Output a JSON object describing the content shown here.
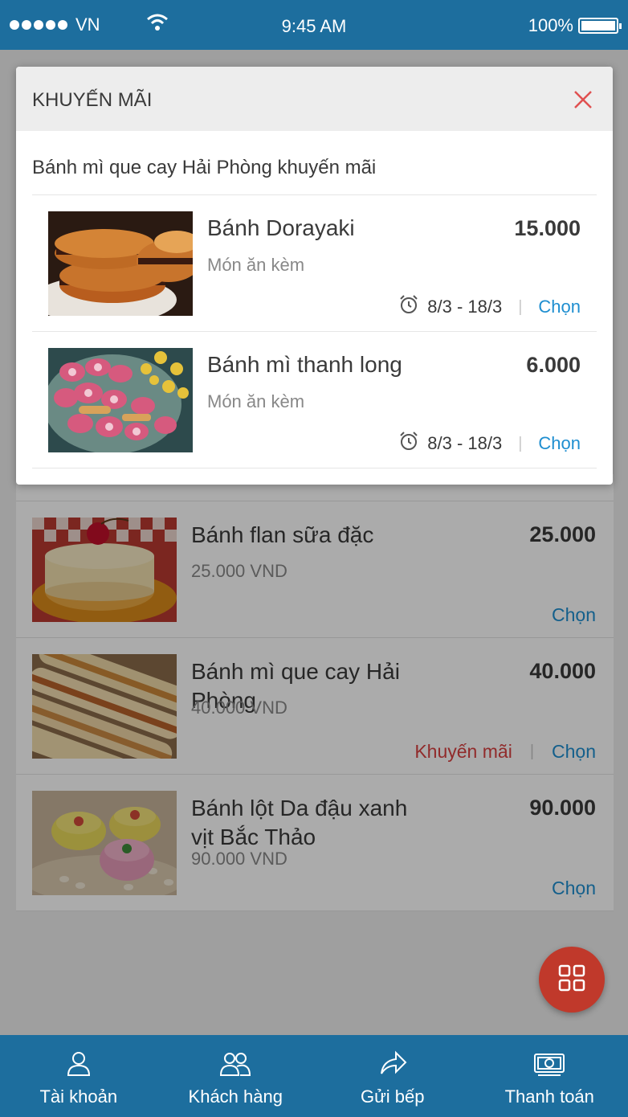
{
  "status_bar": {
    "carrier": "VN",
    "time": "9:45 AM",
    "battery": "100%"
  },
  "modal": {
    "title": "KHUYẾN MÃI",
    "subtitle": "Bánh mì que cay Hải Phòng khuyến mãi",
    "items": [
      {
        "name": "Bánh Dorayaki",
        "price": "15.000",
        "category": "Món ăn kèm",
        "date_range": "8/3 - 18/3",
        "action": "Chọn"
      },
      {
        "name": "Bánh mì thanh long",
        "price": "6.000",
        "category": "Món ăn kèm",
        "date_range": "8/3 - 18/3",
        "action": "Chọn"
      }
    ]
  },
  "menu": {
    "items": [
      {
        "name": "Bánh flan sữa đặc",
        "price": "25.000",
        "subprice": "25.000 VND",
        "choose": "Chọn"
      },
      {
        "name": "Bánh mì que cay Hải Phòng",
        "price": "40.000",
        "subprice": "40.000 VND",
        "promo": "Khuyến mãi",
        "choose": "Chọn"
      },
      {
        "name": "Bánh lột Da đậu xanh vịt Bắc Thảo",
        "price": "90.000",
        "subprice": "90.000 VND",
        "choose": "Chọn"
      }
    ]
  },
  "bottom_nav": [
    {
      "label": "Tài khoản",
      "icon": "user-icon"
    },
    {
      "label": "Khách hàng",
      "icon": "customers-icon"
    },
    {
      "label": "Gửi bếp",
      "icon": "share-icon"
    },
    {
      "label": "Thanh toán",
      "icon": "cash-icon"
    }
  ],
  "colors": {
    "primary": "#1d6e9e",
    "accent_red": "#d84040",
    "link_blue": "#1e8ed0",
    "fab": "#c0392b"
  }
}
